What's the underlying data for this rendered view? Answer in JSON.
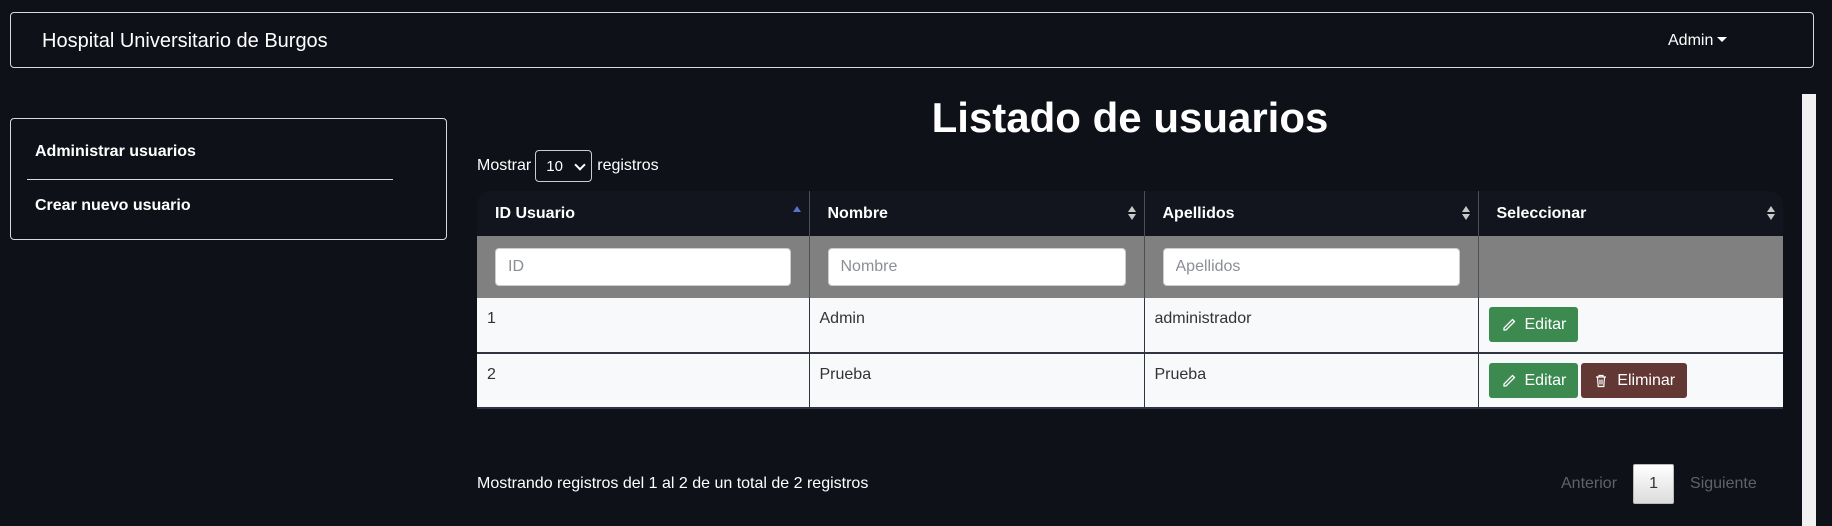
{
  "navbar": {
    "brand": "Hospital Universitario de Burgos",
    "user_menu": "Admin"
  },
  "sidebar": {
    "items": [
      {
        "label": "Administrar usuarios"
      },
      {
        "label": "Crear nuevo usuario"
      }
    ]
  },
  "page": {
    "title": "Listado de usuarios"
  },
  "length": {
    "prefix": "Mostrar",
    "value": "10",
    "suffix": "registros"
  },
  "table": {
    "columns": [
      "ID Usuario",
      "Nombre",
      "Apellidos",
      "Seleccionar"
    ],
    "filters": {
      "id_placeholder": "ID",
      "nombre_placeholder": "Nombre",
      "apellidos_placeholder": "Apellidos"
    },
    "rows": [
      {
        "id": "1",
        "nombre": "Admin",
        "apellidos": "administrador",
        "edit": "Editar"
      },
      {
        "id": "2",
        "nombre": "Prueba",
        "apellidos": "Prueba",
        "edit": "Editar",
        "delete": "Eliminar"
      }
    ]
  },
  "footer": {
    "info": "Mostrando registros del 1 al 2 de un total de 2 registros",
    "prev": "Anterior",
    "page": "1",
    "next": "Siguiente"
  },
  "colors": {
    "background": "#0e1118",
    "edit": "#3c8a50",
    "delete": "#633734",
    "filter_row": "#808080"
  }
}
